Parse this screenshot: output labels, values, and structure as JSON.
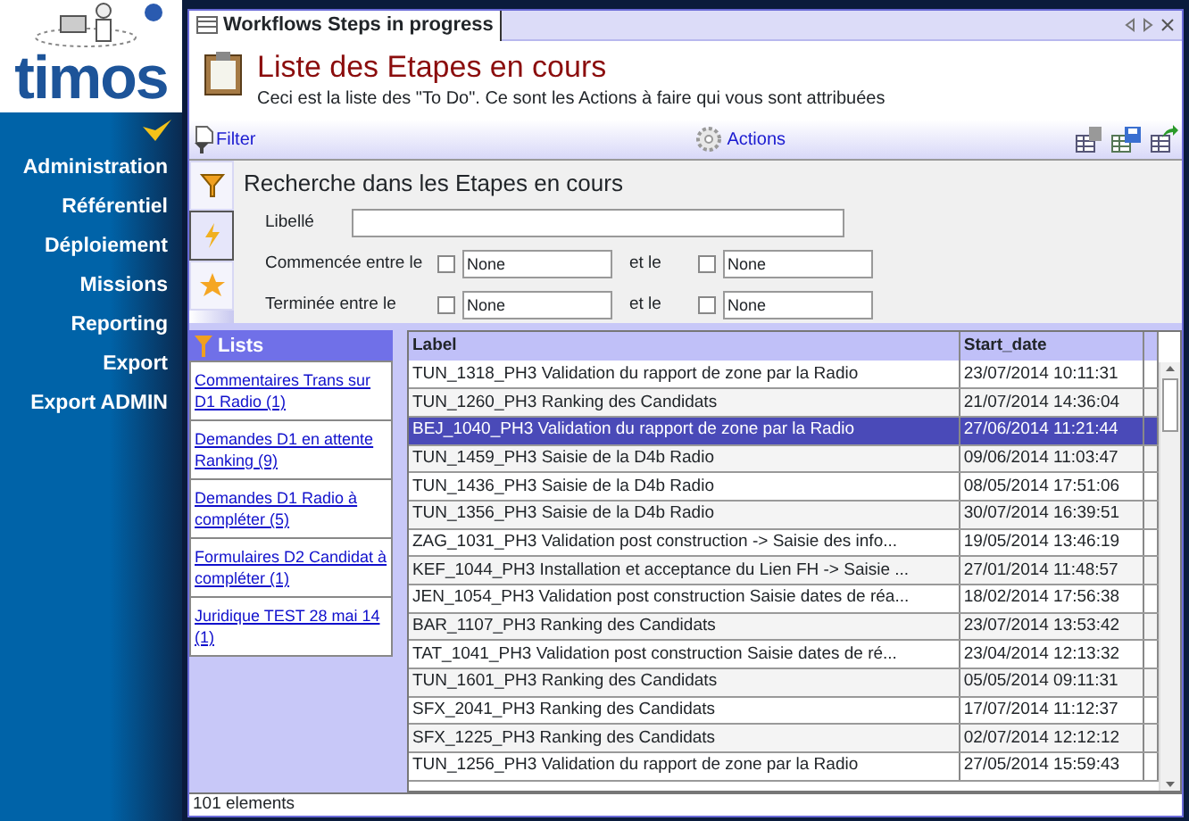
{
  "logo": {
    "text": "timos"
  },
  "nav": [
    "Administration",
    "Référentiel",
    "Déploiement",
    "Missions",
    "Reporting",
    "Export",
    "Export ADMIN"
  ],
  "tab": {
    "title": "Workflows Steps in progress"
  },
  "header": {
    "title": "Liste des Etapes en cours",
    "subtitle": "Ceci est la liste des \"To Do\". Ce sont les Actions à faire qui vous sont attribuées"
  },
  "toolbar": {
    "filter": "Filter",
    "actions": "Actions"
  },
  "side_tabs": [
    {
      "kind": "filter",
      "selected": false
    },
    {
      "kind": "lightning",
      "selected": true
    },
    {
      "kind": "star",
      "selected": false
    }
  ],
  "search": {
    "title": "Recherche dans les Etapes en cours",
    "label_field": "Libellé",
    "ranges": [
      {
        "label": "Commencée entre le",
        "from": {
          "checked": false,
          "value": "None"
        },
        "and": "et le",
        "to": {
          "checked": false,
          "value": "None"
        }
      },
      {
        "label": "Terminée entre le",
        "from": {
          "checked": false,
          "value": "None"
        },
        "and": "et le",
        "to": {
          "checked": false,
          "value": "None"
        }
      }
    ]
  },
  "lists": {
    "title": "Lists",
    "items": [
      "Commentaires Trans sur D1 Radio (1)",
      "Demandes D1 en attente Ranking (9)",
      "Demandes D1 Radio à compléter (5)",
      "Formulaires D2 Candidat à compléter (1)",
      "Juridique TEST 28 mai 14 (1)"
    ]
  },
  "table": {
    "columns": [
      "Label",
      "Start_date"
    ],
    "rows": [
      {
        "label": "TUN_1318_PH3 Validation du rapport de zone par la Radio",
        "start_date": "23/07/2014 10:11:31",
        "selected": false
      },
      {
        "label": "TUN_1260_PH3 Ranking des Candidats",
        "start_date": "21/07/2014 14:36:04",
        "selected": false
      },
      {
        "label": "BEJ_1040_PH3 Validation du rapport de zone par la Radio",
        "start_date": "27/06/2014 11:21:44",
        "selected": true
      },
      {
        "label": "TUN_1459_PH3 Saisie de la D4b Radio",
        "start_date": "09/06/2014 11:03:47",
        "selected": false
      },
      {
        "label": "TUN_1436_PH3 Saisie de la D4b Radio",
        "start_date": "08/05/2014 17:51:06",
        "selected": false
      },
      {
        "label": "TUN_1356_PH3 Saisie de la D4b Radio",
        "start_date": "30/07/2014 16:39:51",
        "selected": false
      },
      {
        "label": "ZAG_1031_PH3 Validation post construction -> Saisie des info...",
        "start_date": "19/05/2014 13:46:19",
        "selected": false
      },
      {
        "label": "KEF_1044_PH3 Installation et acceptance du Lien FH -> Saisie ...",
        "start_date": "27/01/2014 11:48:57",
        "selected": false
      },
      {
        "label": "JEN_1054_PH3 Validation post construction Saisie dates de réa...",
        "start_date": "18/02/2014 17:56:38",
        "selected": false
      },
      {
        "label": "BAR_1107_PH3 Ranking des Candidats",
        "start_date": "23/07/2014 13:53:42",
        "selected": false
      },
      {
        "label": "TAT_1041_PH3 Validation post construction Saisie dates de ré...",
        "start_date": "23/04/2014 12:13:32",
        "selected": false
      },
      {
        "label": "TUN_1601_PH3 Ranking des Candidats",
        "start_date": "05/05/2014 09:11:31",
        "selected": false
      },
      {
        "label": "SFX_2041_PH3 Ranking des Candidats",
        "start_date": "17/07/2014 11:12:37",
        "selected": false
      },
      {
        "label": "SFX_1225_PH3 Ranking des Candidats",
        "start_date": "02/07/2014 12:12:12",
        "selected": false
      },
      {
        "label": "TUN_1256_PH3 Validation du rapport de zone par la Radio",
        "start_date": "27/05/2014 15:59:43",
        "selected": false
      }
    ]
  },
  "status_bar": "101 elements"
}
